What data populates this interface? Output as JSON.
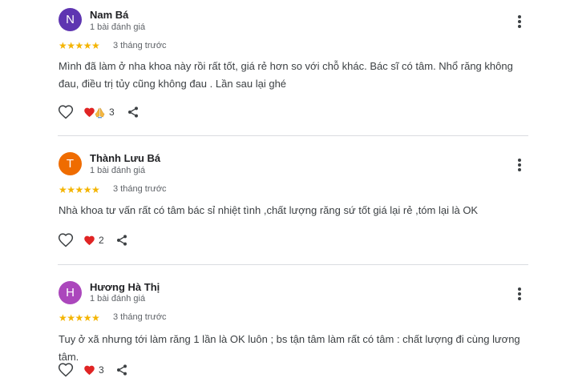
{
  "reviews": [
    {
      "initial": "N",
      "avatar_color": "#5e35b1",
      "name": "Nam Bá",
      "meta": "1 bài đánh giá",
      "stars": "★★★★★",
      "time": "3 tháng trước",
      "text": "Mình đã làm ở nha khoa này rồi rất tốt, giá rẻ hơn so với chỗ khác. Bác sĩ có tâm. Nhổ răng không đau, điều trị tủy cũng không đau . Lần sau lại ghé",
      "reaction_icons": [
        "heart-icon",
        "praying-hands-icon"
      ],
      "reaction_count": "3"
    },
    {
      "initial": "T",
      "avatar_color": "#ef6c00",
      "name": "Thành Lưu Bá",
      "meta": "1 bài đánh giá",
      "stars": "★★★★★",
      "time": "3 tháng trước",
      "text": "Nhà khoa tư vấn rất có tâm bác sỉ nhiệt tình ,chất lượng răng sứ tốt giá lại rẻ ,tóm lại là OK",
      "reaction_icons": [
        "heart-icon"
      ],
      "reaction_count": "2"
    },
    {
      "initial": "H",
      "avatar_color": "#ab47bc",
      "name": "Hương Hà Thị",
      "meta": "1 bài đánh giá",
      "stars": "★★★★★",
      "time": "3 tháng trước",
      "text": "Tuy ở xã nhưng tới làm răng 1 lần là OK luôn ; bs tận tâm làm rất có tâm : chất lượng đi cùng lương tâm.",
      "reaction_icons": [
        "heart-icon"
      ],
      "reaction_count": "3"
    }
  ],
  "icons": {
    "like": "thumb-up-outline-icon",
    "more": "more-vert-icon",
    "share": "share-icon"
  },
  "colors": {
    "star": "#f4b400",
    "heart": "#e02424",
    "divider": "#dadce0"
  }
}
